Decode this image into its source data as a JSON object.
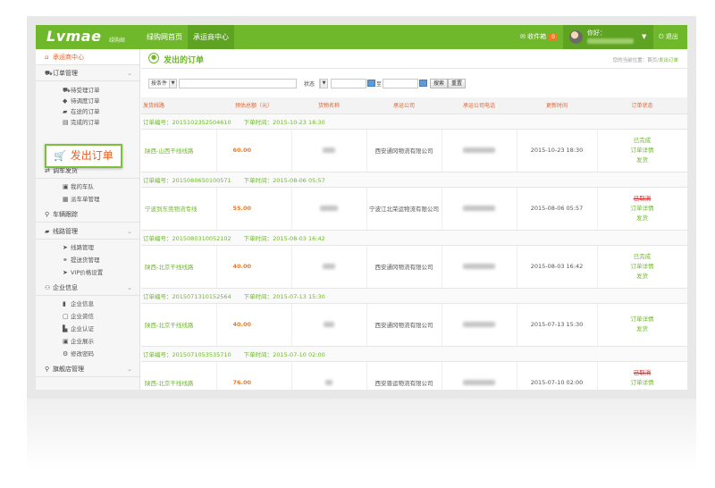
{
  "header": {
    "logo_text": "Lvmae",
    "logo_sub": "绿购邮",
    "nav": [
      "绿购网首页",
      "承运商中心"
    ],
    "inbox_label": "收件箱",
    "inbox_count": "0",
    "hello": "你好：",
    "logout": "退出",
    "brand_color": "#6fb82b"
  },
  "sidebar": {
    "home": "承运商中心",
    "order_mgmt": "订单管理",
    "order_items": [
      "待受理订单",
      "待调度订单",
      "在途的订单",
      "完成的订单"
    ],
    "dispatch": "调车发货",
    "dispatch_items": [
      "我的车队",
      "派车单管理"
    ],
    "tracking": "车辆跟踪",
    "route_mgmt": "线路管理",
    "route_items": [
      "线路管理",
      "提送货管理",
      "VIP价格设置"
    ],
    "company": "企业信息",
    "company_items": [
      "企业信息",
      "企业资信",
      "企业认证",
      "企业展示",
      "修改密码"
    ],
    "flagship": "旗舰店管理",
    "callout": "发出订单"
  },
  "page": {
    "title": "发出的订单",
    "crumb_prefix": "您的当前位置：首页",
    "crumb_current": "发出订单"
  },
  "filters": {
    "condition": "按条件",
    "status_label": "状态",
    "to": "至",
    "search": "搜索",
    "reset": "重置"
  },
  "table": {
    "columns": [
      "发货线路",
      "预估总额（元）",
      "货物名称",
      "承运公司",
      "承运公司电话",
      "更新时间",
      "订单状态"
    ],
    "order_no_label": "订单编号：",
    "order_time_label": "下单时间：",
    "detail": "订单详情",
    "ship": "发货",
    "orders": [
      {
        "no": "2015102352504610",
        "time": "2015-10-23 18:30",
        "route": "陕西-山西干线线路",
        "price": "60.00",
        "company": "西安通冈物流有限公司",
        "updated": "2015-10-23 18:30",
        "status": "已完成",
        "status_type": "done"
      },
      {
        "no": "2015080650100571",
        "time": "2015-08-06 05:57",
        "route": "宁波到东莞物流专线",
        "price": "55.00",
        "company": "宁波江北荣运物流有限公司",
        "updated": "2015-08-06 05:57",
        "status": "已取消",
        "status_type": "cancel"
      },
      {
        "no": "2015080310052102",
        "time": "2015-08-03 16:42",
        "route": "陕西-北京干线线路",
        "price": "40.00",
        "company": "西安通冈物流有限公司",
        "updated": "2015-08-03 16:42",
        "status": "已完成",
        "status_type": "done"
      },
      {
        "no": "2015071310152564",
        "time": "2015-07-13 15:30",
        "route": "陕西-北京干线线路",
        "price": "40.00",
        "company": "西安通冈物流有限公司",
        "updated": "2015-07-13 15:30",
        "status": "",
        "status_type": "none"
      },
      {
        "no": "2015071053535710",
        "time": "2015-07-10 02:00",
        "route": "陕西-北京干线线路",
        "price": "76.00",
        "company": "西安晋运物流有限公司",
        "updated": "2015-07-10 02:00",
        "status": "已取消",
        "status_type": "cancel"
      }
    ]
  }
}
